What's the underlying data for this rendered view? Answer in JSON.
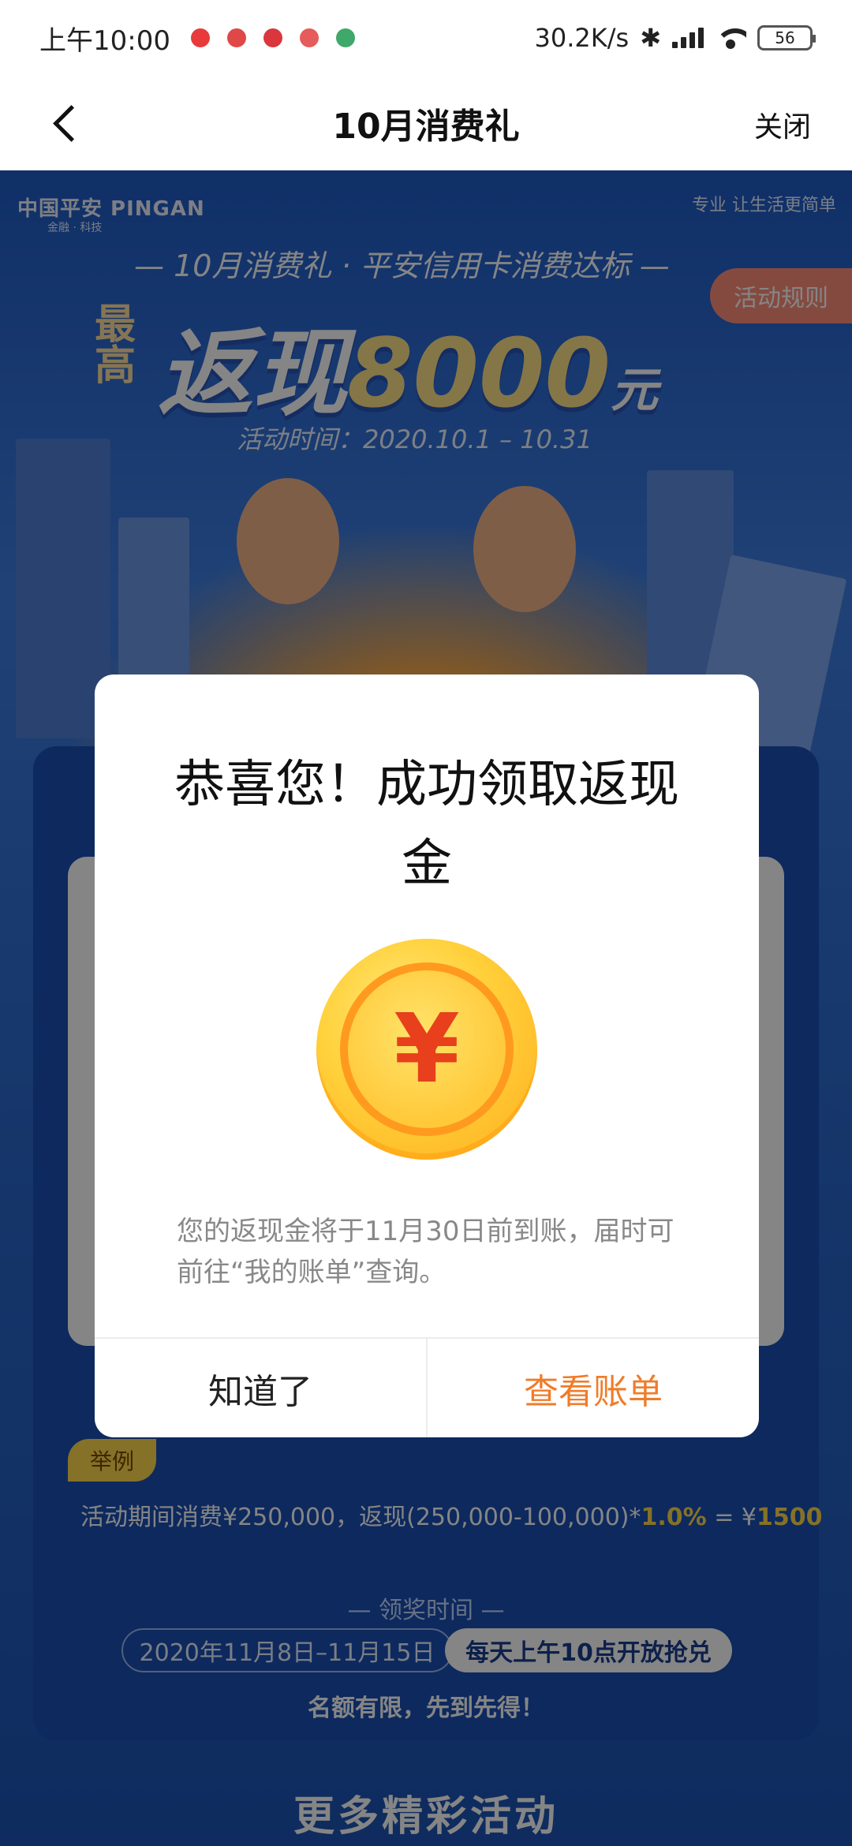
{
  "status_bar": {
    "time": "上午10:00",
    "net_speed": "30.2K/s",
    "battery": "56"
  },
  "nav": {
    "title": "10月消费礼",
    "close_label": "关闭"
  },
  "banner": {
    "brand": "中国平安 PINGAN",
    "brand_sub": "金融 · 科技",
    "slogan": "专业 让生活更简单",
    "subtitle": "— 10月消费礼 · 平安信用卡消费达标 —",
    "headline_prefix": "最高",
    "headline_main": "返现",
    "headline_amount": "8000",
    "headline_unit": "元",
    "activity_time": "活动时间：2020.10.1 – 10.31",
    "rules_button": "活动规则"
  },
  "example": {
    "tag": "举例",
    "text_prefix": "活动期间消费¥250,000，返现(250,000-100,000)*",
    "rate": "1.0%",
    "equals": " = ¥",
    "result": "1500"
  },
  "award": {
    "label": "— 领奖时间 —",
    "date": "2020年11月8日–11月15日",
    "open": "每天上午10点开放抢兑",
    "limited": "名额有限，先到先得！"
  },
  "more_activities": "更多精彩活动",
  "dialog": {
    "title": "恭喜您！成功领取返现金",
    "coin_symbol": "¥",
    "message": "您的返现金将于11月30日前到账，届时可前往“我的账单”查询。",
    "btn_ok": "知道了",
    "btn_view": "查看账单"
  },
  "colors": {
    "accent_orange": "#f07c2a",
    "page_blue": "#1a4fb5",
    "coin_gold": "#ffc93a"
  }
}
